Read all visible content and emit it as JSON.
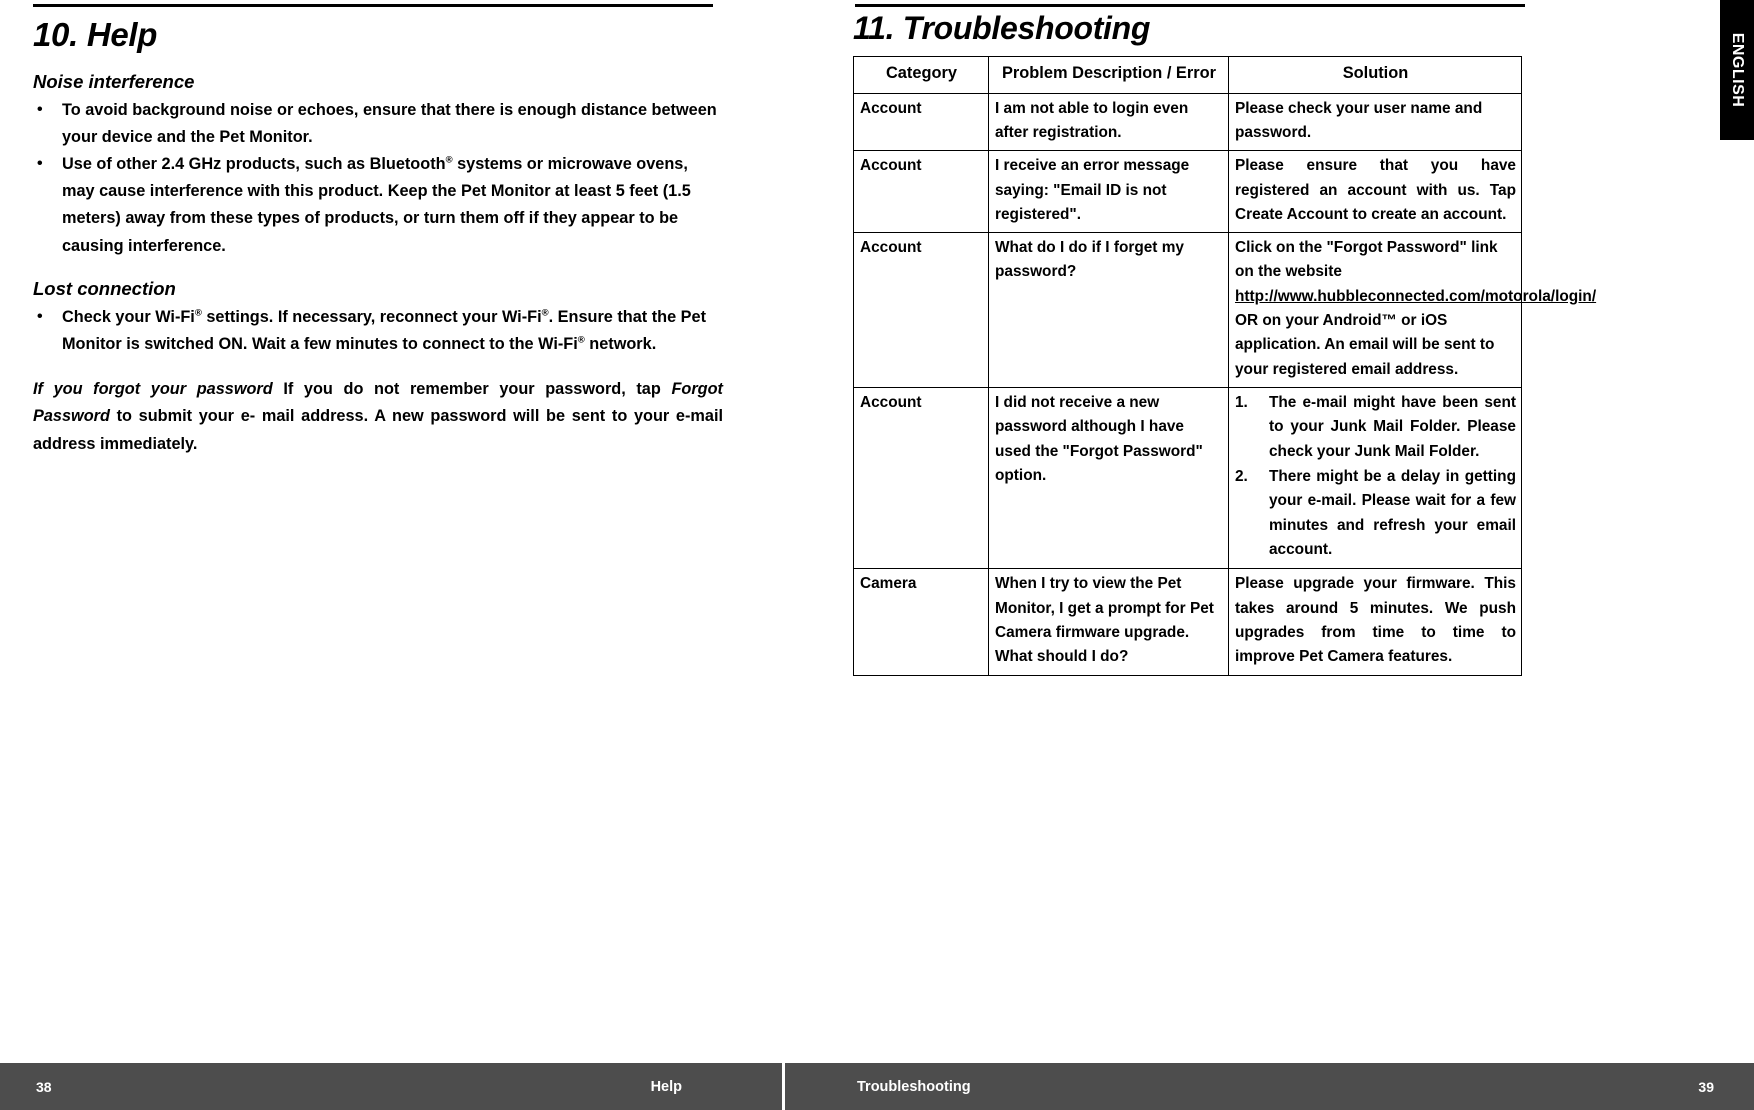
{
  "language_tab": "ENGLISH",
  "left_page": {
    "chapter_title": "10. Help",
    "sections": [
      {
        "heading": "Noise interference",
        "bullets": [
          "To avoid background  noise or echoes,  ensure that there  is enough distance between  your device  and the Pet Monitor.",
          "Use of other  2.4  GHz  products,   such as Bluetooth® systems or microwave ovens, may cause interference  with this product. Keep the Pet Monitor at least 5 feet  (1.5  meters) away from these types of products, or turn them  off if they appear  to be  causing interference."
        ]
      },
      {
        "heading": "Lost connection",
        "bullets": [
          "Check your Wi-Fi® settings. If necessary, reconnect  your Wi-Fi®. Ensure that the Pet Monitor is switched ON.  Wait  a few minutes to connect  to the Wi-Fi® network."
        ]
      }
    ],
    "forgot_password": {
      "lead_italic": "If you forgot your password",
      "body_before_italic": " If you do not remember  your password, tap ",
      "inline_italic": "Forgot  Password",
      "body_after_italic": " to submit your e- mail address. A new password will be  sent to your e-mail address immediately."
    }
  },
  "right_page": {
    "chapter_title": "11. Troubleshooting",
    "table": {
      "headers": [
        "Category",
        "Problem Description / Error",
        "Solution"
      ],
      "rows": [
        {
          "category": "Account",
          "problem": "I am not able to login even after registration.",
          "solution_type": "text",
          "solution": "Please check  your user name and password."
        },
        {
          "category": "Account",
          "problem": "I receive  an error message saying:  \"Email  ID  is not registered\".",
          "solution_type": "text",
          "solution": "Please ensure that you have registered  an  account  with  us. Tap  Create  Account  to create an account."
        },
        {
          "category": "Account",
          "problem": "What  do I do if I forget my password?",
          "solution_type": "link",
          "solution_pre": "Click on the \"Forgot  Password\" link on the website ",
          "solution_link": "http://www.hubbleconnected.com/motorola/login/",
          "solution_post": " OR on your Android™  or iOS application. An email will be  sent to your registered email address."
        },
        {
          "category": "Account",
          "problem": "I did not receive a new password although I have used the \"Forgot Password\" option.",
          "solution_type": "list",
          "solution_items": [
            {
              "num": "1.",
              "text": "The e-mail might have been sent  to  your  Junk Mail  Folder. Please check  your Junk Mail Folder."
            },
            {
              "num": "2.",
              "text": "There might be  a delay in getting  your  e-mail.  Please wait  for a  few  minutes and refresh your email account."
            }
          ]
        },
        {
          "category": "Camera",
          "problem": "When  I try to view the Pet Monitor, I get a prompt for Pet Camera firmware upgrade.  What  should I do?",
          "solution_type": "text",
          "solution": "Please upgrade  your firmware. This takes  around  5  minutes.  We push upgrades from time to time to improve Pet Camera  features."
        }
      ]
    }
  },
  "footer": {
    "left_page_number": "38",
    "left_section": "Help",
    "right_section": "Troubleshooting",
    "right_page_number": "39"
  }
}
